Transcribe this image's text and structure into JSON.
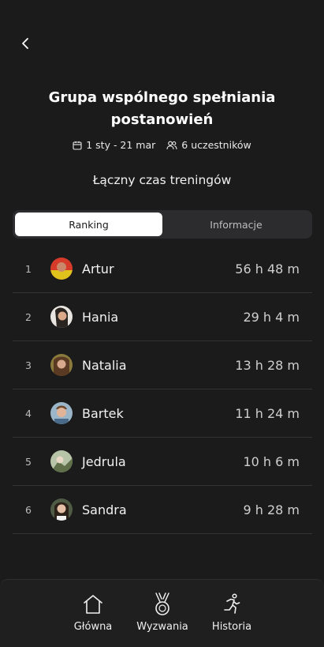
{
  "header": {
    "title": "Grupa wspólnego spełniania postanowień",
    "dates": "1 sty - 21 mar",
    "participants": "6 uczestników",
    "subtitle": "Łączny czas treningów"
  },
  "tabs": [
    {
      "label": "Ranking",
      "active": true
    },
    {
      "label": "Informacje",
      "active": false
    }
  ],
  "ranking": [
    {
      "rank": "1",
      "name": "Artur",
      "time": "56 h 48 m",
      "avatar_color": "#d63b2a"
    },
    {
      "rank": "2",
      "name": "Hania",
      "time": "29 h 4 m",
      "avatar_color": "#e8e4df"
    },
    {
      "rank": "3",
      "name": "Natalia",
      "time": "13 h 28 m",
      "avatar_color": "#8a7a3c"
    },
    {
      "rank": "4",
      "name": "Bartek",
      "time": "11 h 24 m",
      "avatar_color": "#9bb6c8"
    },
    {
      "rank": "5",
      "name": "Jedrula",
      "time": "10 h 6 m",
      "avatar_color": "#b7c4a8"
    },
    {
      "rank": "6",
      "name": "Sandra",
      "time": "9 h 28 m",
      "avatar_color": "#4f5b45"
    }
  ],
  "nav": [
    {
      "label": "Główna",
      "icon": "home-icon"
    },
    {
      "label": "Wyzwania",
      "icon": "medal-icon"
    },
    {
      "label": "Historia",
      "icon": "running-icon"
    }
  ],
  "colors": {
    "background": "#1b1b1c",
    "tab_active_bg": "#ffffff",
    "tab_bar_bg": "#2c2c2e",
    "divider": "#333335"
  }
}
